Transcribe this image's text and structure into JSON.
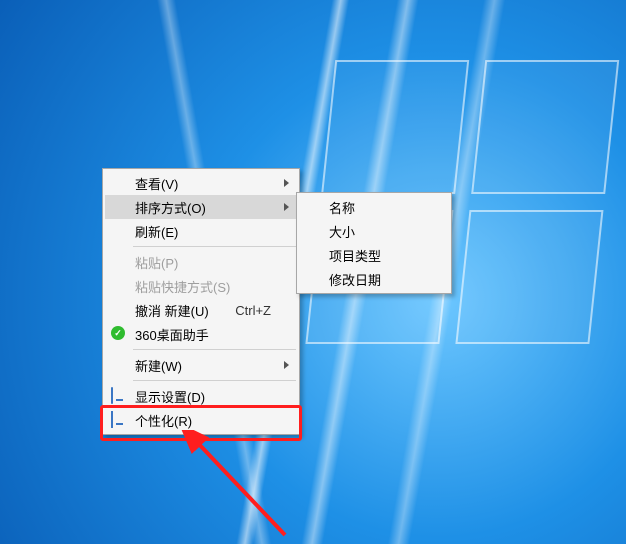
{
  "context_menu": {
    "items": [
      {
        "key": "view",
        "label": "查看(V)",
        "submenu": true
      },
      {
        "key": "sort",
        "label": "排序方式(O)",
        "submenu": true,
        "hover": true
      },
      {
        "key": "refresh",
        "label": "刷新(E)"
      },
      {
        "sep": true
      },
      {
        "key": "paste",
        "label": "粘贴(P)",
        "disabled": true
      },
      {
        "key": "paste-short",
        "label": "粘贴快捷方式(S)",
        "disabled": true
      },
      {
        "key": "undo-new",
        "label": "撤消 新建(U)",
        "shortcut": "Ctrl+Z"
      },
      {
        "key": "360",
        "label": "360桌面助手",
        "icon": "360-icon"
      },
      {
        "sep": true
      },
      {
        "key": "new",
        "label": "新建(W)",
        "submenu": true
      },
      {
        "sep": true
      },
      {
        "key": "display",
        "label": "显示设置(D)",
        "icon": "display-icon"
      },
      {
        "key": "personalize",
        "label": "个性化(R)",
        "icon": "personalize-icon",
        "highlighted": true
      }
    ]
  },
  "sort_submenu": {
    "items": [
      {
        "key": "name",
        "label": "名称"
      },
      {
        "key": "size",
        "label": "大小"
      },
      {
        "key": "type",
        "label": "项目类型"
      },
      {
        "key": "date",
        "label": "修改日期"
      }
    ]
  }
}
